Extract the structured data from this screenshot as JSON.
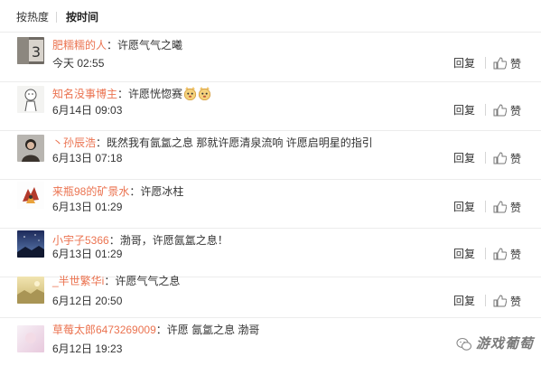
{
  "sort_tabs": {
    "by_hot": "按热度",
    "by_time": "按时间"
  },
  "actions": {
    "reply_label": "回复",
    "like_label": "赞",
    "like_icon": "thumbs-up-icon"
  },
  "comments": [
    {
      "user": "肥糯糯的人",
      "colon": "：",
      "text": "许愿气气之曦",
      "time": "今天 02:55",
      "avatar": "avatar-number-3-icon"
    },
    {
      "user": "知名没事博主",
      "colon": "：",
      "text": "许愿恍惚赛",
      "time": "6月14日 09:03",
      "avatar": "avatar-sketch-figure-icon",
      "emoji": [
        "cute-face-emoji-icon",
        "cute-face-emoji-icon"
      ]
    },
    {
      "user": "丶孙辰浩",
      "colon": "：",
      "text": "既然我有氤氲之息 那就许愿清泉流响 许愿启明星的指引",
      "time": "6月13日 07:18",
      "avatar": "avatar-person-photo-icon"
    },
    {
      "user": "来瓶98的矿景水",
      "colon": "：",
      "text": "许愿冰柱",
      "time": "6月13日 01:29",
      "avatar": "avatar-dragon-icon"
    },
    {
      "user": "小宇子5366",
      "colon": "：",
      "text": "渤哥，许愿氤氲之息！",
      "time": "6月13日 01:29",
      "avatar": "avatar-night-sky-icon"
    },
    {
      "user": "_半世繁华i",
      "colon": "：",
      "text": "许愿气气之息",
      "time": "6月12日 20:50",
      "avatar": "avatar-landscape-icon"
    },
    {
      "user": "草莓太郎6473269009",
      "colon": "：",
      "text": "许愿 氤氲之息 渤哥",
      "time": "6月12日 19:23",
      "avatar": "avatar-pink-pastel-icon"
    }
  ],
  "watermark": {
    "text": "游戏葡萄",
    "logo": "wechat-logo-icon"
  },
  "colors": {
    "username": "#eb7350",
    "text": "#333333",
    "divider": "#ececec"
  }
}
